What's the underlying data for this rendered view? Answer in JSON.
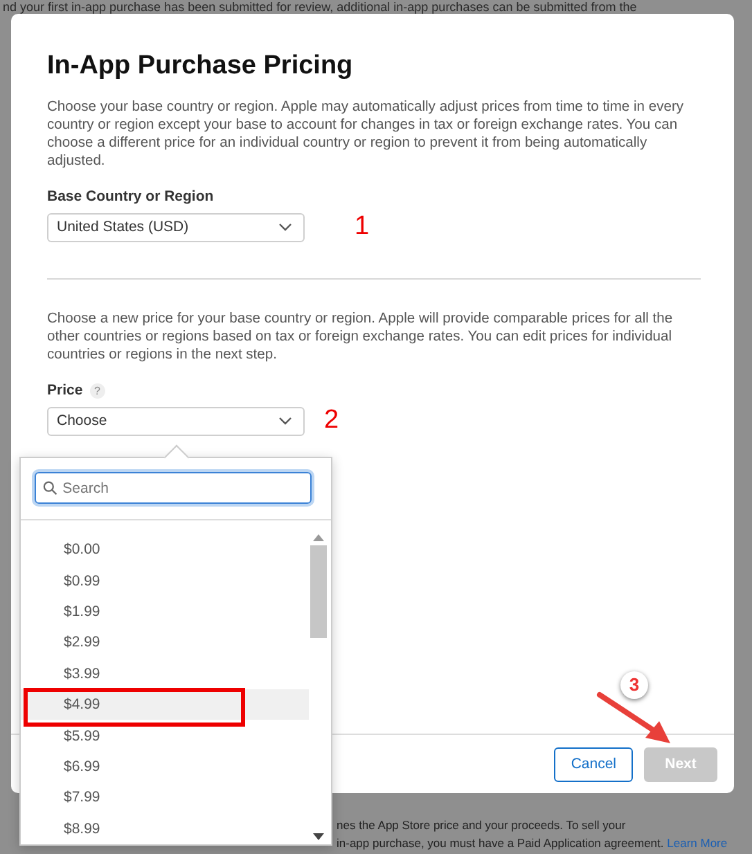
{
  "background": {
    "top_text": "nd your first in-app purchase has been submitted for review, additional in-app purchases can be submitted from the",
    "bottom_lines": [
      "nes the App Store price and your proceeds. To sell your",
      "in-app purchase, you must have a Paid Application agreement."
    ],
    "bottom_link": "Learn More"
  },
  "dialog": {
    "title": "In-App Purchase Pricing",
    "intro": "Choose your base country or region. Apple may automatically adjust prices from time to time in every country or region except your base to account for changes in tax or foreign exchange rates. You can choose a different price for an individual country or region to prevent it from being automatically adjusted.",
    "base_region": {
      "label": "Base Country or Region",
      "value": "United States (USD)",
      "annotation": "1"
    },
    "price_text": "Choose a new price for your base country or region. Apple will provide comparable prices for all the other countries or regions based on tax or foreign exchange rates. You can edit prices for individual countries or regions in the next step.",
    "price": {
      "label": "Price",
      "help": "?",
      "value": "Choose",
      "annotation": "2"
    },
    "buttons": [
      {
        "label": "Cancel",
        "kind": "secondary",
        "disabled": false
      },
      {
        "label": "Next",
        "kind": "primary",
        "disabled": true,
        "annotation": "3"
      }
    ]
  },
  "price_menu": {
    "search": {
      "placeholder": "Search"
    },
    "items": [
      {
        "label": "$0.00",
        "selected": false,
        "annotated": false
      },
      {
        "label": "$0.99",
        "selected": false,
        "annotated": false
      },
      {
        "label": "$1.99",
        "selected": false,
        "annotated": false
      },
      {
        "label": "$2.99",
        "selected": false,
        "annotated": false
      },
      {
        "label": "$3.99",
        "selected": false,
        "annotated": false
      },
      {
        "label": "$4.99",
        "selected": true,
        "annotated": true
      },
      {
        "label": "$5.99",
        "selected": false,
        "annotated": false
      },
      {
        "label": "$6.99",
        "selected": false,
        "annotated": false
      },
      {
        "label": "$7.99",
        "selected": false,
        "annotated": false
      },
      {
        "label": "$8.99",
        "selected": false,
        "annotated": false
      }
    ]
  }
}
